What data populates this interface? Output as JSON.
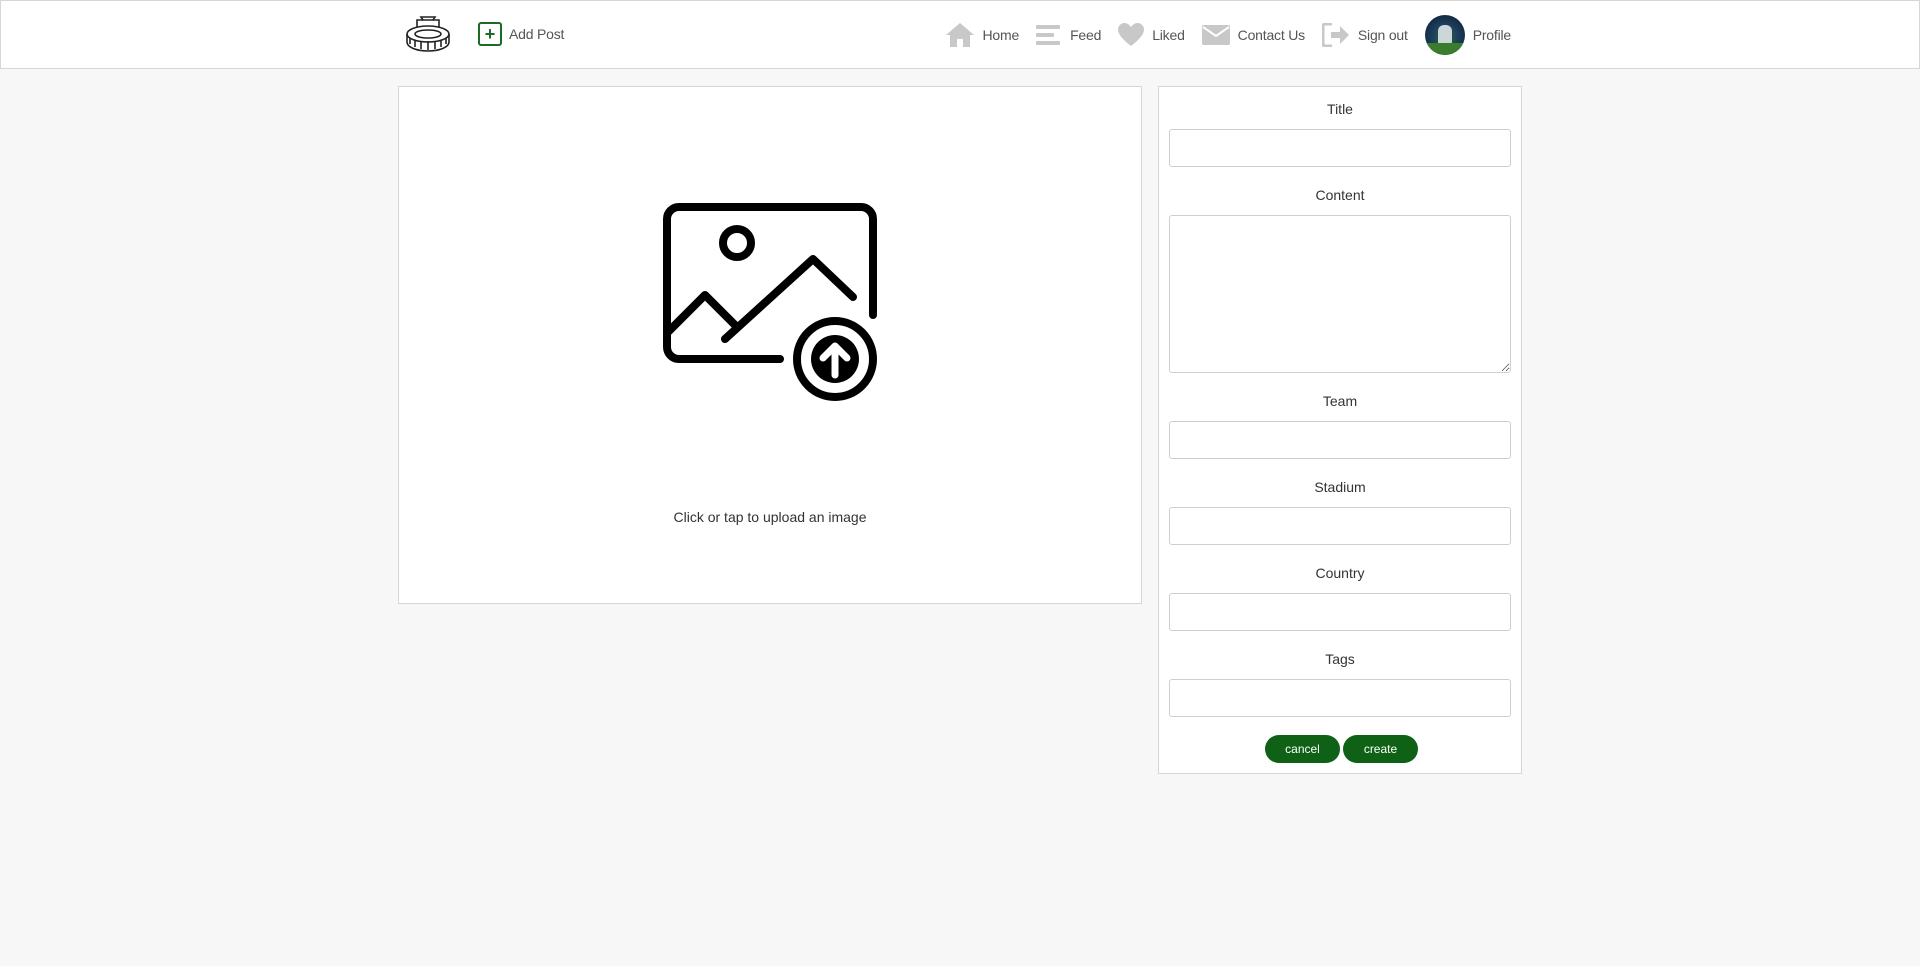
{
  "navbar": {
    "add_post_label": "Add Post",
    "items": [
      {
        "label": "Home",
        "icon": "home-icon"
      },
      {
        "label": "Feed",
        "icon": "menu-lines-icon"
      },
      {
        "label": "Liked",
        "icon": "heart-icon"
      },
      {
        "label": "Contact Us",
        "icon": "envelope-icon"
      },
      {
        "label": "Sign out",
        "icon": "sign-out-icon"
      },
      {
        "label": "Profile",
        "icon": "avatar"
      }
    ],
    "icon_color": "#c8c8c8",
    "accent_color": "#1a6b23"
  },
  "upload": {
    "hint": "Click or tap to upload an image"
  },
  "form": {
    "title_label": "Title",
    "content_label": "Content",
    "team_label": "Team",
    "stadium_label": "Stadium",
    "country_label": "Country",
    "tags_label": "Tags",
    "title_value": "",
    "content_value": "",
    "team_value": "",
    "stadium_value": "",
    "country_value": "",
    "tags_value": "",
    "cancel_label": "cancel",
    "create_label": "create",
    "button_color": "#0e6115"
  }
}
